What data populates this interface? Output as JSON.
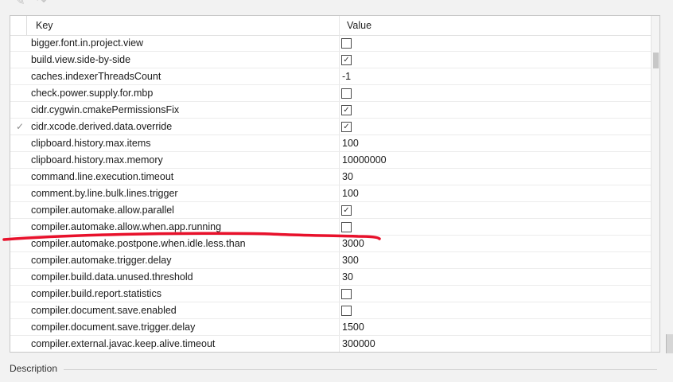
{
  "toolbar": {
    "undo_icon": "undo-icon",
    "redo_icon": "redo-icon"
  },
  "table": {
    "columns": {
      "key": "Key",
      "value": "Value"
    },
    "rows": [
      {
        "key": "bigger.font.in.project.view",
        "type": "checkbox",
        "checked": false,
        "modified": false
      },
      {
        "key": "build.view.side-by-side",
        "type": "checkbox",
        "checked": true,
        "modified": false
      },
      {
        "key": "caches.indexerThreadsCount",
        "type": "text",
        "value": "-1",
        "modified": false
      },
      {
        "key": "check.power.supply.for.mbp",
        "type": "checkbox",
        "checked": false,
        "modified": false
      },
      {
        "key": "cidr.cygwin.cmakePermissionsFix",
        "type": "checkbox",
        "checked": true,
        "modified": false
      },
      {
        "key": "cidr.xcode.derived.data.override",
        "type": "checkbox",
        "checked": true,
        "modified": true,
        "mark": "✓"
      },
      {
        "key": "clipboard.history.max.items",
        "type": "text",
        "value": "100",
        "modified": false
      },
      {
        "key": "clipboard.history.max.memory",
        "type": "text",
        "value": "10000000",
        "modified": false
      },
      {
        "key": "command.line.execution.timeout",
        "type": "text",
        "value": "30",
        "modified": false
      },
      {
        "key": "comment.by.line.bulk.lines.trigger",
        "type": "text",
        "value": "100",
        "modified": false
      },
      {
        "key": "compiler.automake.allow.parallel",
        "type": "checkbox",
        "checked": true,
        "modified": false
      },
      {
        "key": "compiler.automake.allow.when.app.running",
        "type": "checkbox",
        "checked": false,
        "modified": false
      },
      {
        "key": "compiler.automake.postpone.when.idle.less.than",
        "type": "text",
        "value": "3000",
        "modified": false
      },
      {
        "key": "compiler.automake.trigger.delay",
        "type": "text",
        "value": "300",
        "modified": false
      },
      {
        "key": "compiler.build.data.unused.threshold",
        "type": "text",
        "value": "30",
        "modified": false
      },
      {
        "key": "compiler.build.report.statistics",
        "type": "checkbox",
        "checked": false,
        "modified": false
      },
      {
        "key": "compiler.document.save.enabled",
        "type": "checkbox",
        "checked": false,
        "modified": false
      },
      {
        "key": "compiler.document.save.trigger.delay",
        "type": "text",
        "value": "1500",
        "modified": false
      },
      {
        "key": "compiler.external.javac.keep.alive.timeout",
        "type": "text",
        "value": "300000",
        "modified": false
      }
    ]
  },
  "description": {
    "label": "Description"
  },
  "colors": {
    "annotation_stroke": "#e8112b",
    "checkbox_border": "#4b4b4b",
    "grid_line": "#ececec"
  }
}
